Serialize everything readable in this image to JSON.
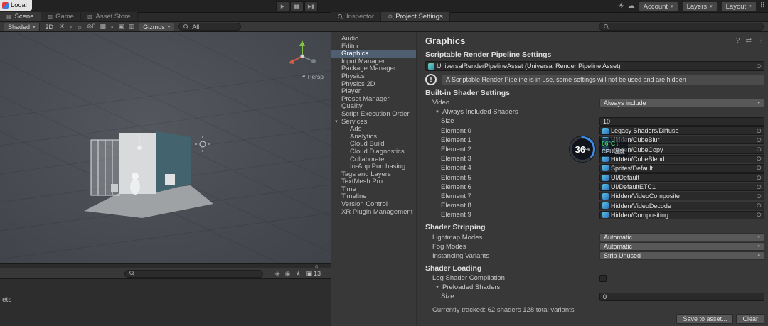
{
  "os": {
    "local_label": "Local"
  },
  "topbar": {
    "account": "Account",
    "layers": "Layers",
    "layout": "Layout"
  },
  "scene": {
    "tabs": [
      {
        "label": "Scene"
      },
      {
        "label": "Game"
      },
      {
        "label": "Asset Store"
      }
    ],
    "toolbar": {
      "shaded": "Shaded",
      "mode_2d": "2D",
      "slash_zero": "⊘0",
      "gizmos": "Gizmos",
      "search_value": "All"
    },
    "viewport": {
      "persp": "Persp"
    }
  },
  "project": {
    "count": "13",
    "assets_label": "ets"
  },
  "tabs_right": [
    {
      "label": "Inspector"
    },
    {
      "label": "Project Settings"
    }
  ],
  "settings_nav": {
    "items": [
      {
        "label": "Audio"
      },
      {
        "label": "Editor"
      },
      {
        "label": "Graphics"
      },
      {
        "label": "Input Manager"
      },
      {
        "label": "Package Manager"
      },
      {
        "label": "Physics"
      },
      {
        "label": "Physics 2D"
      },
      {
        "label": "Player"
      },
      {
        "label": "Preset Manager"
      },
      {
        "label": "Quality"
      },
      {
        "label": "Script Execution Order"
      },
      {
        "label": "Services"
      },
      {
        "label": "Ads"
      },
      {
        "label": "Analytics"
      },
      {
        "label": "Cloud Build"
      },
      {
        "label": "Cloud Diagnostics"
      },
      {
        "label": "Collaborate"
      },
      {
        "label": "In-App Purchasing"
      },
      {
        "label": "Tags and Layers"
      },
      {
        "label": "TextMesh Pro"
      },
      {
        "label": "Time"
      },
      {
        "label": "Timeline"
      },
      {
        "label": "Version Control"
      },
      {
        "label": "XR Plugin Management"
      }
    ]
  },
  "graphics": {
    "title": "Graphics",
    "srp_section": "Scriptable Render Pipeline Settings",
    "srp_asset": "UniversalRenderPipelineAsset (Universal Render Pipeline Asset)",
    "warning": "A Scriptable Render Pipeline is in use, some settings will not be used and are hidden",
    "builtin_section": "Built-in Shader Settings",
    "video_label": "Video",
    "video_value": "Always include",
    "always_included": "Always Included Shaders",
    "size_label": "Size",
    "size_value": "10",
    "elements": [
      {
        "label": "Element 0",
        "value": "Legacy Shaders/Diffuse"
      },
      {
        "label": "Element 1",
        "value": "Hidden/CubeBlur"
      },
      {
        "label": "Element 2",
        "value": "Hidden/CubeCopy"
      },
      {
        "label": "Element 3",
        "value": "Hidden/CubeBlend"
      },
      {
        "label": "Element 4",
        "value": "Sprites/Default"
      },
      {
        "label": "Element 5",
        "value": "UI/Default"
      },
      {
        "label": "Element 6",
        "value": "UI/DefaultETC1"
      },
      {
        "label": "Element 7",
        "value": "Hidden/VideoComposite"
      },
      {
        "label": "Element 8",
        "value": "Hidden/VideoDecode"
      },
      {
        "label": "Element 9",
        "value": "Hidden/Compositing"
      }
    ],
    "stripping_section": "Shader Stripping",
    "lightmap_label": "Lightmap Modes",
    "lightmap_value": "Automatic",
    "fog_label": "Fog Modes",
    "fog_value": "Automatic",
    "instancing_label": "Instancing Variants",
    "instancing_value": "Strip Unused",
    "loading_section": "Shader Loading",
    "log_label": "Log Shader Compilation",
    "preloaded": "Preloaded Shaders",
    "preload_size_label": "Size",
    "preload_size_value": "0",
    "tracked": "Currently tracked: 62 shaders 128 total variants",
    "save_button": "Save to asset...",
    "clear_button": "Clear"
  },
  "cpu": {
    "percent": "36",
    "unit": "%",
    "temp": "66°C",
    "arrow": "↓",
    "label": "CPU温度"
  },
  "colors": {
    "accent_blue": "#3d8eea",
    "selection": "#4f5e70",
    "temp_green": "#3ad06a",
    "axis_green": "#84c341",
    "axis_red": "#d95c4a",
    "warning_bar": "#4b4b4b"
  },
  "icons": {
    "play": "▶",
    "pause": "▮▮",
    "step": "▶▮",
    "caret": "▾",
    "fold": "▼",
    "picker": "⊙",
    "help": "?",
    "kebab": "⋮",
    "swap": "⇄",
    "sun": "☀",
    "cloud": "☁",
    "grid_dots": "⠿",
    "gear": "⚙",
    "light": "☀",
    "audio": "♪",
    "fx": "☼",
    "grid": "▦",
    "close": "×",
    "cam": "▣",
    "bars": "▥",
    "persp_arrow": "◄",
    "star": "★",
    "eye": "◉",
    "package": "◈",
    "bubble": "▣",
    "warning": "!",
    "scene_tab": "▦",
    "game_tab": "▨",
    "store_tab": "▧",
    "mini_a": "a"
  }
}
